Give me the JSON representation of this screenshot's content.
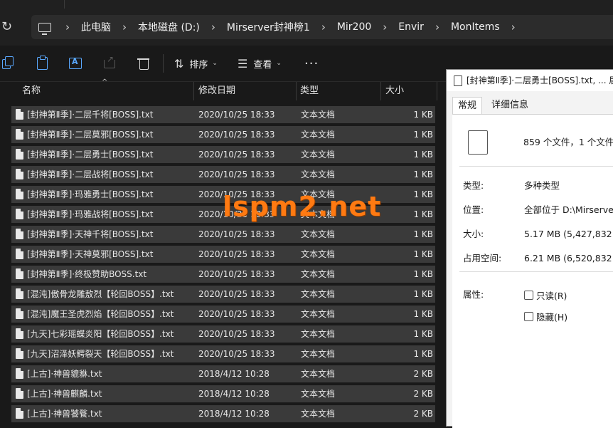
{
  "address": {
    "breadcrumbs": [
      "此电脑",
      "本地磁盘 (D:)",
      "Mirserver封神榜1",
      "Mir200",
      "Envir",
      "MonItems"
    ]
  },
  "toolbar": {
    "sort_label": "排序",
    "view_label": "查看",
    "more_label": "···"
  },
  "columns": {
    "name": "名称",
    "date": "修改日期",
    "type": "类型",
    "size": "大小"
  },
  "files": [
    {
      "name": "[封神第Ⅱ季]·二层千将[BOSS].txt",
      "date": "2020/10/25 18:33",
      "type": "文本文档",
      "size": "1 KB"
    },
    {
      "name": "[封神第Ⅱ季]·二层莫邪[BOSS].txt",
      "date": "2020/10/25 18:33",
      "type": "文本文档",
      "size": "1 KB"
    },
    {
      "name": "[封神第Ⅱ季]·二层勇士[BOSS].txt",
      "date": "2020/10/25 18:33",
      "type": "文本文档",
      "size": "1 KB"
    },
    {
      "name": "[封神第Ⅱ季]·二层战将[BOSS].txt",
      "date": "2020/10/25 18:33",
      "type": "文本文档",
      "size": "1 KB"
    },
    {
      "name": "[封神第Ⅱ季]·玛雅勇士[BOSS].txt",
      "date": "2020/10/25 18:33",
      "type": "文本文档",
      "size": "1 KB"
    },
    {
      "name": "[封神第Ⅱ季]·玛雅战将[BOSS].txt",
      "date": "2020/10/25 18:33",
      "type": "文本文档",
      "size": "1 KB"
    },
    {
      "name": "[封神第Ⅱ季]·天神千将[BOSS].txt",
      "date": "2020/10/25 18:33",
      "type": "文本文档",
      "size": "1 KB"
    },
    {
      "name": "[封神第Ⅱ季]·天神莫邪[BOSS].txt",
      "date": "2020/10/25 18:33",
      "type": "文本文档",
      "size": "1 KB"
    },
    {
      "name": "[封神第Ⅱ季]·终极赞助BOSS.txt",
      "date": "2020/10/25 18:33",
      "type": "文本文档",
      "size": "1 KB"
    },
    {
      "name": "[混沌]傲骨龙雕敖烈【轮回BOSS】.txt",
      "date": "2020/10/25 18:33",
      "type": "文本文档",
      "size": "1 KB"
    },
    {
      "name": "[混沌]魔王圣虎烈焰【轮回BOSS】.txt",
      "date": "2020/10/25 18:33",
      "type": "文本文档",
      "size": "1 KB"
    },
    {
      "name": "[九天]七彩瑶蝶炎阳【轮回BOSS】.txt",
      "date": "2020/10/25 18:33",
      "type": "文本文档",
      "size": "1 KB"
    },
    {
      "name": "[九天]沼泽妖鳄裂天【轮回BOSS】.txt",
      "date": "2020/10/25 18:33",
      "type": "文本文档",
      "size": "1 KB"
    },
    {
      "name": "[上古]·神兽貔貅.txt",
      "date": "2018/4/12 10:28",
      "type": "文本文档",
      "size": "2 KB"
    },
    {
      "name": "[上古]·神兽麒麟.txt",
      "date": "2018/4/12 10:28",
      "type": "文本文档",
      "size": "2 KB"
    },
    {
      "name": "[上古]·神兽饕餮.txt",
      "date": "2018/4/12 10:28",
      "type": "文本文档",
      "size": "2 KB"
    }
  ],
  "watermark": "lspm2.net",
  "properties": {
    "title": "[封神第Ⅱ季]·二层勇士[BOSS].txt, ... 届",
    "tab_general": "常规",
    "tab_details": "详细信息",
    "summary": "859 个文件，1 个文件夹",
    "type_label": "类型:",
    "type_value": "多种类型",
    "location_label": "位置:",
    "location_value": "全部位于 D:\\Mirserver",
    "size_label": "大小:",
    "size_value": "5.17 MB (5,427,832 字",
    "disk_label": "占用空间:",
    "disk_value": "6.21 MB (6,520,832 字",
    "attr_label": "属性:",
    "readonly_label": "只读(R)",
    "hidden_label": "隐藏(H)"
  }
}
